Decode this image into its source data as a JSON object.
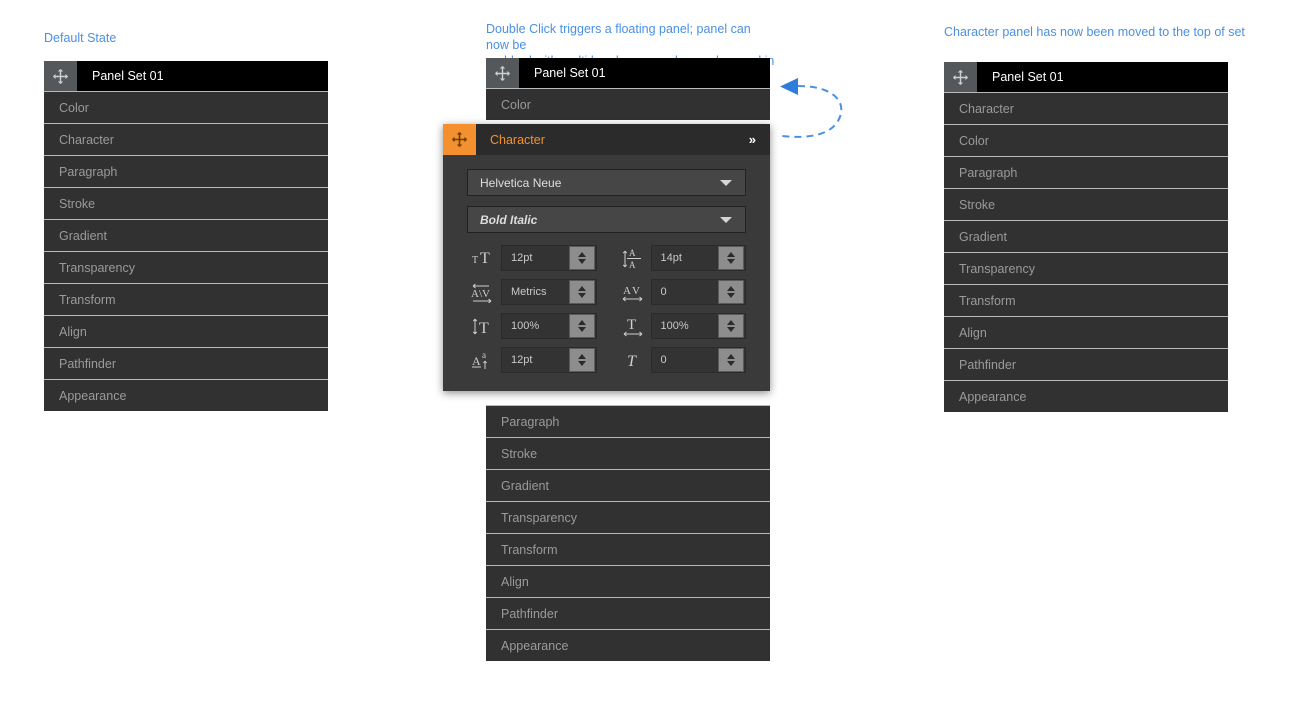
{
  "annotations": {
    "left": "Default State",
    "middle_line1": "Double Click triggers a floating panel; panel can now be",
    "middle_line2": "grabbed with multi head arrow and moved around in set",
    "right": "Character panel has now been moved to the top of set"
  },
  "colors": {
    "accent_orange": "#f4912e",
    "annotation_blue": "#4a90e2",
    "panel_row_bg": "#313131",
    "panel_header_bg": "#000000",
    "drag_handle_bg": "#55585a",
    "row_divider": "#b9b9b9",
    "row_text": "#9a9a9a",
    "float_panel_bg": "#3a3a3a"
  },
  "panel_left": {
    "header_title": "Panel Set 01",
    "drag_handle_icon": "move-cross-icon",
    "rows": [
      "Color",
      "Character",
      "Paragraph",
      "Stroke",
      "Gradient",
      "Transparency",
      "Transform",
      "Align",
      "Pathfinder",
      "Appearance"
    ]
  },
  "panel_middle": {
    "header_title": "Panel Set 01",
    "drag_handle_icon": "move-cross-icon",
    "rows_top": [
      "Color"
    ],
    "rows_bottom": [
      "Paragraph",
      "Stroke",
      "Gradient",
      "Transparency",
      "Transform",
      "Align",
      "Pathfinder",
      "Appearance"
    ]
  },
  "floating_panel": {
    "title": "Character",
    "drag_handle_icon": "move-cross-icon",
    "collapse_icon": "double-chevron-right-icon",
    "font_family": {
      "value": "Helvetica Neue",
      "caret_icon": "caret-down-icon"
    },
    "font_style": {
      "value": "Bold Italic",
      "caret_icon": "caret-down-icon"
    },
    "fields": [
      {
        "icon": "font-size-icon",
        "value": "12pt",
        "stepper_icon": "stepper-updown-icon"
      },
      {
        "icon": "leading-icon",
        "value": "14pt",
        "stepper_icon": "stepper-updown-icon"
      },
      {
        "icon": "kerning-icon",
        "value": "Metrics",
        "stepper_icon": "stepper-updown-icon"
      },
      {
        "icon": "tracking-icon",
        "value": "0",
        "stepper_icon": "stepper-updown-icon"
      },
      {
        "icon": "vertical-scale-icon",
        "value": "100%",
        "stepper_icon": "stepper-updown-icon"
      },
      {
        "icon": "horizontal-scale-icon",
        "value": "100%",
        "stepper_icon": "stepper-updown-icon"
      },
      {
        "icon": "baseline-shift-icon",
        "value": "12pt",
        "stepper_icon": "stepper-updown-icon"
      },
      {
        "icon": "skew-italic-icon",
        "value": "0",
        "stepper_icon": "stepper-updown-icon"
      }
    ]
  },
  "panel_right": {
    "header_title": "Panel Set 01",
    "drag_handle_icon": "move-cross-icon",
    "rows": [
      "Character",
      "Color",
      "Paragraph",
      "Stroke",
      "Gradient",
      "Transparency",
      "Transform",
      "Align",
      "Pathfinder",
      "Appearance"
    ]
  },
  "arrow_annotation": {
    "icon": "curved-dashed-arrow-left-icon"
  }
}
